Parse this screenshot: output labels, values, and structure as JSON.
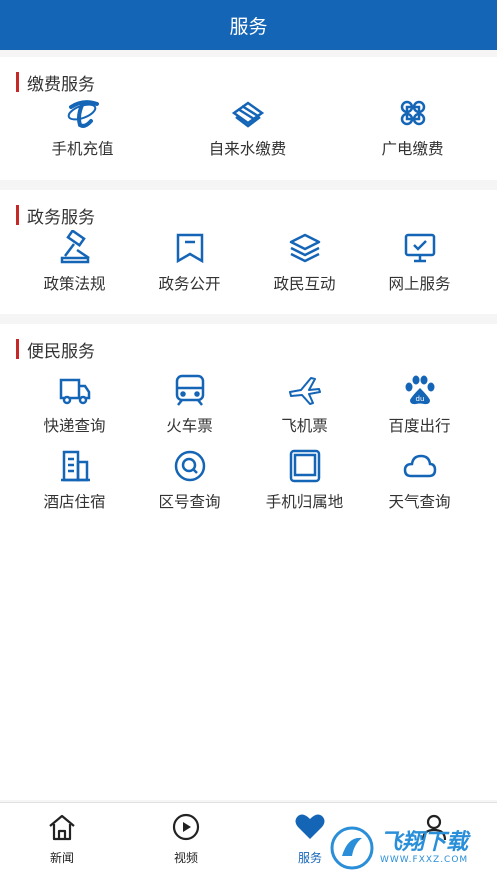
{
  "header": {
    "title": "服务"
  },
  "sections": [
    {
      "title": "缴费服务",
      "items": [
        {
          "label": "手机充值",
          "icon": "telecom-icon"
        },
        {
          "label": "自来水缴费",
          "icon": "mobile-logo-icon"
        },
        {
          "label": "广电缴费",
          "icon": "unicom-knot-icon"
        }
      ]
    },
    {
      "title": "政务服务",
      "items": [
        {
          "label": "政策法规",
          "icon": "gavel-icon"
        },
        {
          "label": "政务公开",
          "icon": "bookmark-icon"
        },
        {
          "label": "政民互动",
          "icon": "layers-icon"
        },
        {
          "label": "网上服务",
          "icon": "monitor-check-icon"
        }
      ]
    },
    {
      "title": "便民服务",
      "items": [
        {
          "label": "快递查询",
          "icon": "truck-icon"
        },
        {
          "label": "火车票",
          "icon": "train-icon"
        },
        {
          "label": "飞机票",
          "icon": "airplane-icon"
        },
        {
          "label": "百度出行",
          "icon": "baidu-paw-icon"
        },
        {
          "label": "酒店住宿",
          "icon": "building-icon"
        },
        {
          "label": "区号查询",
          "icon": "search-circle-icon"
        },
        {
          "label": "手机归属地",
          "icon": "tablet-icon"
        },
        {
          "label": "天气查询",
          "icon": "cloud-icon"
        }
      ]
    }
  ],
  "tabbar": [
    {
      "label": "新闻",
      "icon": "home-icon"
    },
    {
      "label": "视频",
      "icon": "play-circle-icon"
    },
    {
      "label": "服务",
      "icon": "heart-icon",
      "active": true
    },
    {
      "label": "",
      "icon": "user-icon"
    }
  ],
  "watermark": {
    "text": "飞翔下载",
    "url": "WWW.FXXZ.COM"
  },
  "colors": {
    "primary": "#1565b7",
    "accent_bar": "#c62828",
    "background": "#f5f5f5"
  }
}
